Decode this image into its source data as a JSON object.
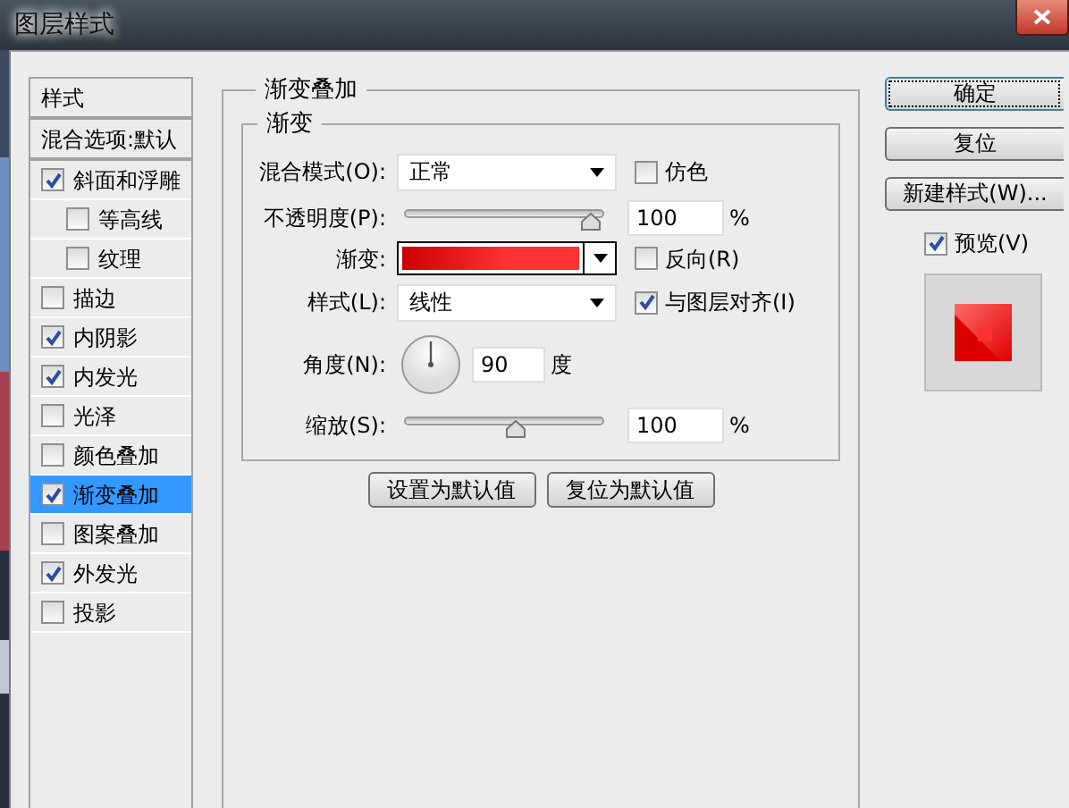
{
  "window": {
    "title": "图层样式"
  },
  "styles_list": {
    "header": "样式",
    "items": [
      {
        "label": "混合选项:默认",
        "kind": "plain",
        "selected": false
      },
      {
        "label": "斜面和浮雕",
        "kind": "check",
        "checked": true,
        "selected": false,
        "children": [
          {
            "label": "等高线",
            "kind": "check",
            "checked": false,
            "selected": false
          },
          {
            "label": "纹理",
            "kind": "check",
            "checked": false,
            "selected": false
          }
        ]
      },
      {
        "label": "描边",
        "kind": "check",
        "checked": false,
        "selected": false
      },
      {
        "label": "内阴影",
        "kind": "check",
        "checked": true,
        "selected": false
      },
      {
        "label": "内发光",
        "kind": "check",
        "checked": true,
        "selected": false
      },
      {
        "label": "光泽",
        "kind": "check",
        "checked": false,
        "selected": false
      },
      {
        "label": "颜色叠加",
        "kind": "check",
        "checked": false,
        "selected": false
      },
      {
        "label": "渐变叠加",
        "kind": "check",
        "checked": true,
        "selected": true
      },
      {
        "label": "图案叠加",
        "kind": "check",
        "checked": false,
        "selected": false
      },
      {
        "label": "外发光",
        "kind": "check",
        "checked": true,
        "selected": false
      },
      {
        "label": "投影",
        "kind": "check",
        "checked": false,
        "selected": false
      }
    ]
  },
  "panel": {
    "title": "渐变叠加",
    "group": {
      "title": "渐变",
      "blend_mode": {
        "label": "混合模式(O):",
        "value": "正常"
      },
      "dither": {
        "label": "仿色",
        "checked": false
      },
      "opacity": {
        "label": "不透明度(P):",
        "level": 1.0,
        "value": "100",
        "unit": "%"
      },
      "gradient": {
        "label": "渐变:"
      },
      "reverse": {
        "label": "反向(R)",
        "checked": false
      },
      "style": {
        "label": "样式(L):",
        "value": "线性"
      },
      "align": {
        "label": "与图层对齐(I)",
        "checked": true
      },
      "angle": {
        "label": "角度(N):",
        "value": "90",
        "unit": "度"
      },
      "scale": {
        "label": "缩放(S):",
        "level": 0.6,
        "value": "100",
        "unit": "%"
      }
    },
    "buttons": [
      "设置为默认值",
      "复位为默认值"
    ]
  },
  "actions": [
    {
      "label": "确定",
      "default": true
    },
    {
      "label": "复位",
      "default": false
    },
    {
      "label": "新建样式(W)...",
      "default": false
    }
  ],
  "preview": {
    "label": "预览(V)",
    "checked": true
  }
}
